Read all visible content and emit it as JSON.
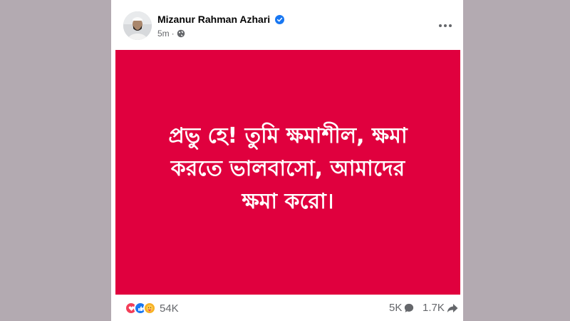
{
  "post": {
    "author": "Mizanur Rahman Azhari",
    "verified": true,
    "time": "5m",
    "privacy_icon": "globe-icon",
    "text": "প্রভু হে! তুমি ক্ষমাশীল, ক্ষমা করতে ভালবাসো, আমাদের ক্ষমা করো।",
    "background_color": "#e0003e"
  },
  "footer": {
    "reaction_icons": [
      "love-icon",
      "like-icon",
      "care-icon"
    ],
    "reaction_count": "54K",
    "comment_count": "5K",
    "share_count": "1.7K"
  },
  "colors": {
    "page_background": "#b3aab1",
    "card": "#ffffff",
    "like_blue": "#1877f2",
    "love_red": "#f33e58",
    "care_yellow": "#f7b125"
  }
}
